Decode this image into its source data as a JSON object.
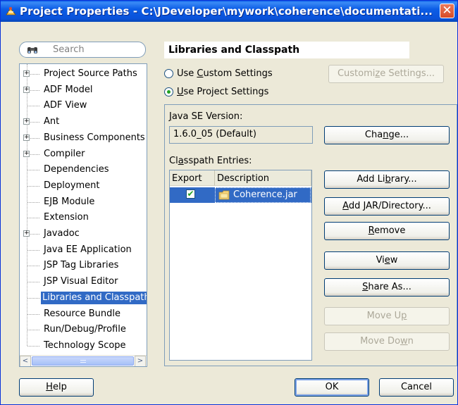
{
  "window": {
    "title": "Project Properties - C:\\JDeveloper\\mywork\\coherence\\documentati...",
    "close_glyph": "✕"
  },
  "search": {
    "placeholder": "Search",
    "icon": "binoculars-icon"
  },
  "tree": {
    "items": [
      {
        "label": "Project Source Paths",
        "expandable": true
      },
      {
        "label": "ADF Model",
        "expandable": true
      },
      {
        "label": "ADF View",
        "expandable": false
      },
      {
        "label": "Ant",
        "expandable": true
      },
      {
        "label": "Business Components",
        "expandable": true
      },
      {
        "label": "Compiler",
        "expandable": true
      },
      {
        "label": "Dependencies",
        "expandable": false
      },
      {
        "label": "Deployment",
        "expandable": false
      },
      {
        "label": "EJB Module",
        "expandable": false
      },
      {
        "label": "Extension",
        "expandable": false
      },
      {
        "label": "Javadoc",
        "expandable": true
      },
      {
        "label": "Java EE Application",
        "expandable": false
      },
      {
        "label": "JSP Tag Libraries",
        "expandable": false
      },
      {
        "label": "JSP Visual Editor",
        "expandable": false
      },
      {
        "label": "Libraries and Classpath",
        "expandable": false,
        "selected": true
      },
      {
        "label": "Resource Bundle",
        "expandable": false
      },
      {
        "label": "Run/Debug/Profile",
        "expandable": false
      },
      {
        "label": "Technology Scope",
        "expandable": false
      }
    ],
    "expand_glyph": "+",
    "scroll_left": "<",
    "scroll_right": ">"
  },
  "panel": {
    "title": "Libraries and Classpath",
    "radio_custom": {
      "pre": "Use ",
      "mnemonic": "C",
      "post": "ustom Settings",
      "checked": false
    },
    "radio_project": {
      "pre": "",
      "mnemonic": "U",
      "post": "se Project Settings",
      "checked": true
    },
    "customize_button": {
      "pre": "Customi",
      "mnemonic": "z",
      "post": "e Settings...",
      "enabled": false
    },
    "java_version_label": {
      "pre": "",
      "mnemonic": "J",
      "post": "ava SE Version:"
    },
    "java_version_value": "1.6.0_05 (Default)",
    "change_button": {
      "pre": "Cha",
      "mnemonic": "n",
      "post": "ge..."
    },
    "classpath_label": {
      "pre": "Cl",
      "mnemonic": "a",
      "post": "sspath Entries:"
    },
    "table": {
      "columns": [
        "Export",
        "Description"
      ],
      "rows": [
        {
          "export": true,
          "description": "Coherence.jar",
          "icon": "jar-file-icon"
        }
      ],
      "check_glyph": "✔"
    },
    "buttons": {
      "add_library": {
        "pre": "Add Li",
        "mnemonic": "b",
        "post": "rary...",
        "enabled": true
      },
      "add_jar": {
        "pre": "",
        "mnemonic": "A",
        "post": "dd JAR/Directory...",
        "enabled": true
      },
      "remove": {
        "pre": "",
        "mnemonic": "R",
        "post": "emove",
        "enabled": true
      },
      "view": {
        "pre": "Vi",
        "mnemonic": "e",
        "post": "w",
        "enabled": true
      },
      "share_as": {
        "pre": "",
        "mnemonic": "S",
        "post": "hare As...",
        "enabled": true
      },
      "move_up": {
        "pre": "Move U",
        "mnemonic": "p",
        "post": "",
        "enabled": false
      },
      "move_down": {
        "pre": "Move Do",
        "mnemonic": "w",
        "post": "n",
        "enabled": false
      }
    }
  },
  "footer": {
    "help": {
      "pre": "",
      "mnemonic": "H",
      "post": "elp"
    },
    "ok": "OK",
    "cancel": "Cancel"
  },
  "colors": {
    "title_bar": "#0a5ee8",
    "selection": "#316ac5",
    "window_bg": "#ece9d8",
    "close_button": "#d84b26"
  }
}
